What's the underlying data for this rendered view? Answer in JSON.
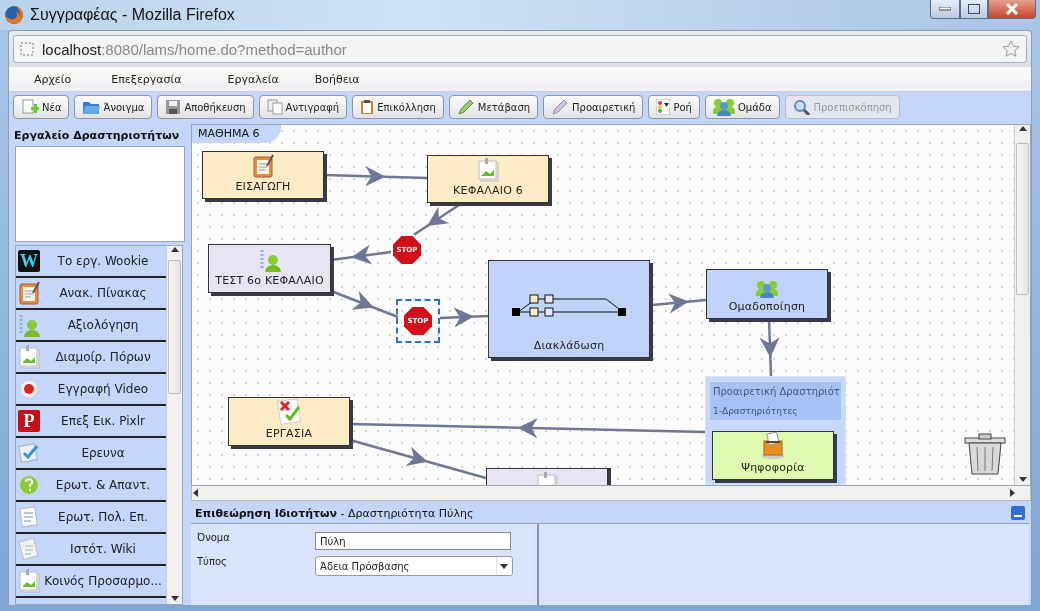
{
  "window": {
    "title": "Συγγραφέας - Mozilla Firefox"
  },
  "address_bar": {
    "host": "localhost",
    "path": ":8080/lams/home.do?method=author"
  },
  "menu": [
    "Αρχείο",
    "Επεξεργασία",
    "Εργαλεία",
    "Βοήθεια"
  ],
  "toolbar": [
    {
      "label": "Νέα",
      "disabled": false
    },
    {
      "label": "Άνοιγμα",
      "disabled": false
    },
    {
      "label": "Αποθήκευση",
      "disabled": false
    },
    {
      "label": "Αντιγραφή",
      "disabled": false
    },
    {
      "label": "Επικόλληση",
      "disabled": false
    },
    {
      "label": "Μετάβαση",
      "disabled": false
    },
    {
      "label": "Προαιρετική",
      "disabled": false
    },
    {
      "label": "Ροή",
      "disabled": false
    },
    {
      "label": "Ομάδα",
      "disabled": false
    },
    {
      "label": "Προεπισκόπηση",
      "disabled": true
    }
  ],
  "sidebar": {
    "title": "Εργαλείο Δραστηριοτήτων",
    "tools": [
      {
        "label": "Το εργ. Wookie",
        "logo_letter": "W"
      },
      {
        "label": "Ανακ. Πίνακας"
      },
      {
        "label": "Αξιολόγηση"
      },
      {
        "label": "Διαμοίρ. Πόρων"
      },
      {
        "label": "Εγγραφή Video"
      },
      {
        "label": "Επεξ Εικ. Pixlr",
        "logo_letter": "P"
      },
      {
        "label": "Ερευνα"
      },
      {
        "label": "Ερωτ. & Απαντ."
      },
      {
        "label": "Ερωτ. Πολ. Επ."
      },
      {
        "label": "Ιστότ. Wiki"
      },
      {
        "label": "Κοινός Προσαρμο..."
      }
    ]
  },
  "lesson_tab": "ΜΑΘΗΜΑ 6",
  "canvas": {
    "activities": [
      {
        "label": "ΕΙΣΑΓΩΓΗ",
        "color": "#fdebc6",
        "selected": false
      },
      {
        "label": "ΚΕΦΑΛΑΙΟ 6",
        "color": "#fdebc6",
        "selected": false
      },
      {
        "label": "ΤΕΣΤ 6ο ΚΕΦΑΛΑΙΟ",
        "color": "#e8e4f4",
        "selected": false
      },
      {
        "label": "Διακλάδωση",
        "color": "#c0d4fb",
        "selected": false
      },
      {
        "label": "Ομαδοποίηση",
        "color": "#c0d4fb",
        "selected": false
      },
      {
        "label": "ΕΡΓΑΣΙΑ",
        "color": "#fdebc6",
        "selected": false
      },
      {
        "color": "#e8e4f4",
        "selected": false
      }
    ],
    "gates": [
      {
        "label": "STOP",
        "selected": false
      },
      {
        "label": "STOP",
        "selected": true
      }
    ],
    "optional_group": {
      "title": "Προαιρετική Δραστηριότ",
      "subtitle": "1-Δραστηριότητες",
      "children": [
        {
          "label": "Ψηφοφορία",
          "color": "#e0f9b0",
          "selected": false
        }
      ]
    }
  },
  "properties": {
    "title": "**Επιθεώρηση Ιδιοτήτων** - Δραστηριότητα Πύλης",
    "fields": [
      {
        "label": "Όνομα",
        "kind": "text",
        "value": "Πύλη"
      },
      {
        "label": "Τύπος",
        "kind": "select",
        "value": "Άδεια Πρόσβασης"
      }
    ]
  }
}
